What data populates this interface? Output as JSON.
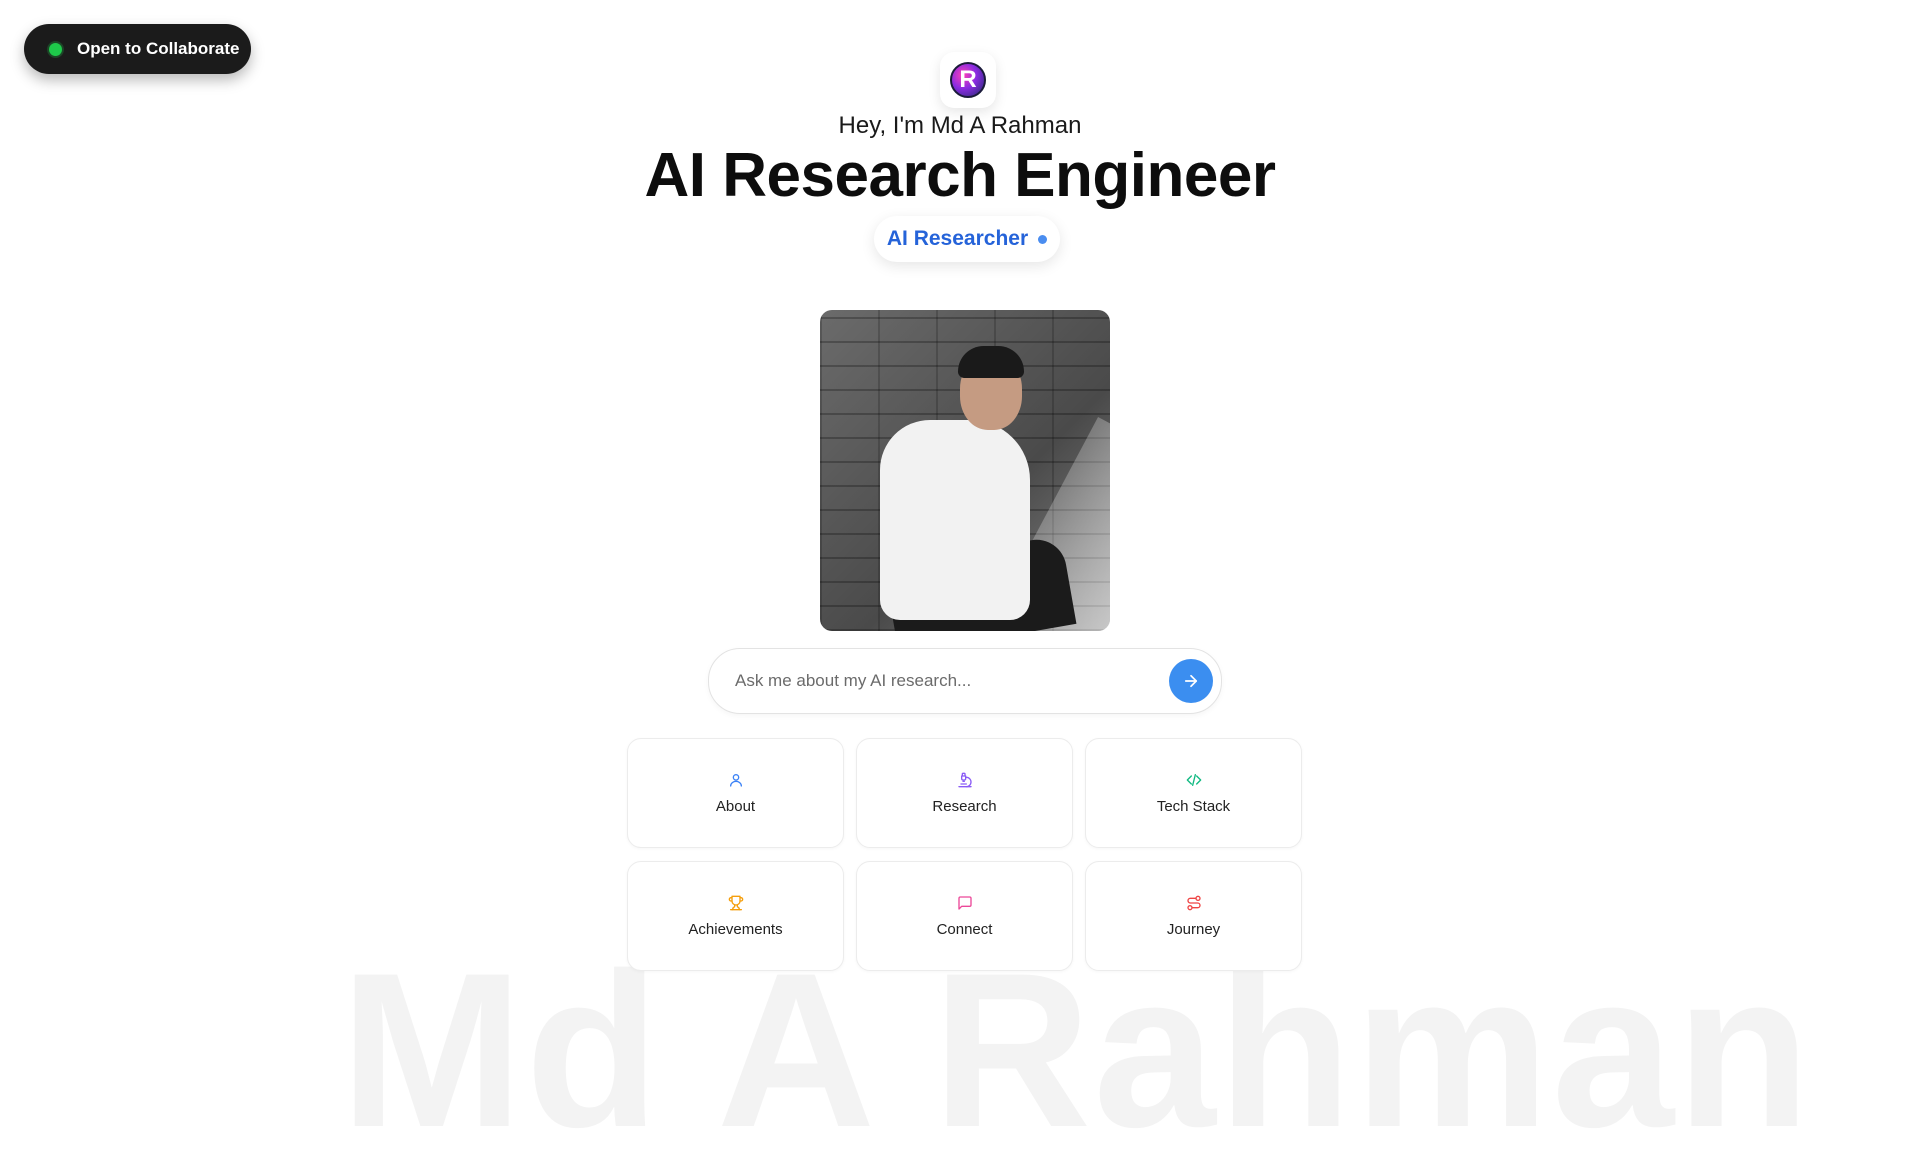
{
  "collab_badge": {
    "label": "Open to Collaborate",
    "status_color": "#1ec94a"
  },
  "logo": {
    "letter": "R"
  },
  "hero": {
    "greeting": "Hey, I'm Md A Rahman",
    "title": "AI Research Engineer",
    "role": "AI Researcher"
  },
  "watermark": "Md A Rahman",
  "ask": {
    "placeholder": "Ask me about my AI research...",
    "send_icon": "arrow-right-icon"
  },
  "cards": [
    {
      "label": "About",
      "icon": "user-icon",
      "color": "#3b82f6"
    },
    {
      "label": "Research",
      "icon": "microscope-icon",
      "color": "#8b5cf6"
    },
    {
      "label": "Tech Stack",
      "icon": "code-icon",
      "color": "#10b981"
    },
    {
      "label": "Achievements",
      "icon": "trophy-icon",
      "color": "#f59e0b"
    },
    {
      "label": "Connect",
      "icon": "message-icon",
      "color": "#ec4899"
    },
    {
      "label": "Journey",
      "icon": "route-icon",
      "color": "#ef4444"
    }
  ]
}
